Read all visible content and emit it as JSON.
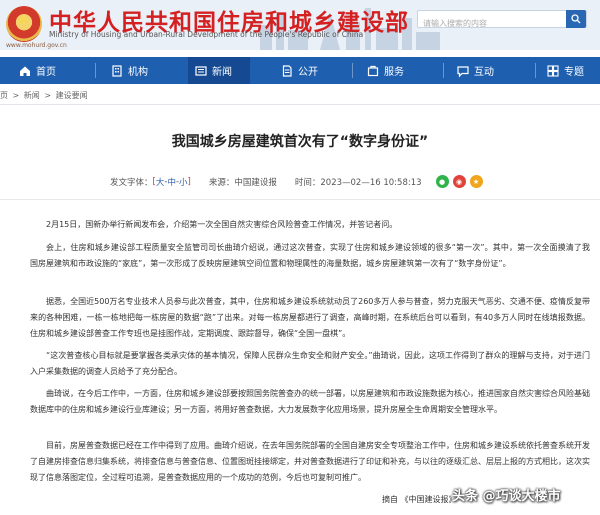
{
  "header": {
    "title": "中华人民共和国住房和城乡建设部",
    "subtitle": "Ministry of Housing and Urban-Rural Development of the People's Republic of China",
    "url": "www.mohurd.gov.cn",
    "search_placeholder": "请输入搜索的内容",
    "colors": {
      "title": "#d42020",
      "nav": "#1f5fb0"
    }
  },
  "nav": {
    "items": [
      {
        "label": "首页",
        "icon": "home-icon"
      },
      {
        "label": "机构",
        "icon": "building-icon"
      },
      {
        "label": "新闻",
        "icon": "news-icon",
        "active": true
      },
      {
        "label": "公开",
        "icon": "document-icon"
      },
      {
        "label": "服务",
        "icon": "service-icon"
      },
      {
        "label": "互动",
        "icon": "chat-icon"
      },
      {
        "label": "专题",
        "icon": "topic-icon"
      }
    ]
  },
  "breadcrumb": [
    "页",
    ">",
    "新闻",
    ">",
    "建设要闻"
  ],
  "article": {
    "title": "我国城乡房屋建筑首次有了“数字身份证”",
    "font_label": "发文字体：",
    "font_open": "[",
    "font_large": "大",
    "font_medium": "中",
    "font_small": "小",
    "font_close": "]",
    "font_sep": "-",
    "source": "来源：中国建设报",
    "time": "时间：2023—02—16 10:58:13",
    "paragraphs": [
      "2月15日，国新办举行新闻发布会，介绍第一次全国自然灾害综合风险普查工作情况，并答记者问。",
      "会上，住房和城乡建设部工程质量安全监管司司长曲琦介绍说，通过这次普查，实现了住房和城乡建设领域的很多“第一次”。其中，第一次全面摸清了我国房屋建筑和市政设施的“家底”，第一次形成了反映房屋建筑空间位置和物理属性的海量数据，城乡房屋建筑第一次有了“数字身份证”。",
      "据悉，全国近500万名专业技术人员参与此次普查，其中，住房和城乡建设系统就动员了260多万人参与普查，努力克服天气恶劣、交通不便、疫情反复带来的各种困难，一栋一栋地把每一栋房屋的数据“跑”了出来。对每一栋房屋都进行了调查，高峰时期，在系统后台可以看到，有40多万人同时在线填报数据。住房和城乡建设部普查工作专班也是挂图作战，定期调度、跟踪督导，确保“全国一盘棋”。",
      "“这次普查核心目标就是要掌握各类承灾体的基本情况，保障人民群众生命安全和财产安全。”曲琦说，因此，这项工作得到了群众的理解与支持，对于进门入户采集数据的调查人员给予了充分配合。",
      "曲琦说，在今后工作中，一方面，住房和城乡建设部要按照国务院普查办的统一部署，以房屋建筑和市政设施数据为核心，推进国家自然灾害综合风险基础数据库中的住房和城乡建设行业库建设；另一方面，将用好普查数据，大力发展数字化应用场景，提升房屋全生命周期安全管理水平。",
      "目前，房屋普查数据已经在工作中得到了应用。曲琦介绍说，在去年国务院部署的全国自建房安全专项整治工作中，住房和城乡建设系统依托普查系统开发了自建房排查信息归集系统，将排查信息与普查信息、位置图斑挂接绑定，并对普查数据进行了印证和补充，与以往的逐级汇总、层层上报的方式相比，这次实现了信息落图定位，全过程可追溯，是普查数据应用的一个成功的范例，今后也可复制可推广。"
    ],
    "footer_source": "摘自 《中国建设报》",
    "watermark": "头条 @巧谈大楼市"
  },
  "share_icons": [
    {
      "name": "wechat-icon",
      "color": "#2fb34a"
    },
    {
      "name": "weibo-icon",
      "color": "#e0433a"
    },
    {
      "name": "qzone-icon",
      "color": "#f0a51c"
    }
  ]
}
